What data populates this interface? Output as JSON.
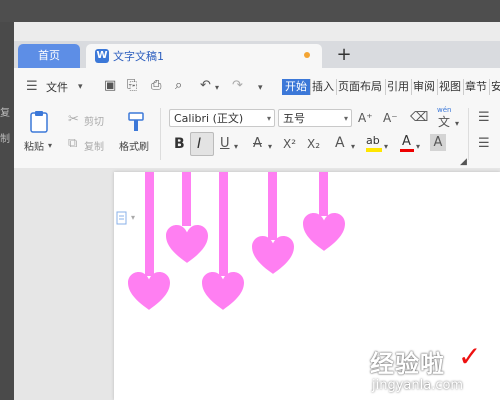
{
  "left_fragments": [
    "复",
    "制"
  ],
  "tabs": {
    "home_label": "首页",
    "doc_label": "文字文稿1",
    "doc_badge": "W",
    "new_tab_glyph": "+"
  },
  "menubar": {
    "file_label": "文件",
    "tabs": [
      "开始",
      "插入",
      "页面布局",
      "引用",
      "审阅",
      "视图",
      "章节",
      "安"
    ]
  },
  "ribbon": {
    "paste_label": "粘贴",
    "cut_label": "剪切",
    "copy_label": "复制",
    "format_painter_label": "格式刷",
    "font_name": "Calibri (正文)",
    "font_size": "五号",
    "bold": "B",
    "italic": "I",
    "underline": "U",
    "strikethrough": "A",
    "superscript": "X²",
    "subscript": "X₂",
    "text_effect": "A",
    "highlight": "ab",
    "font_color": "A",
    "char_shading": "A",
    "grow_font": "A⁺",
    "shrink_font": "A⁻",
    "phonetic_top": "wén",
    "phonetic_bottom": "文"
  },
  "document": {
    "heart_color": "#ff7ff2"
  },
  "watermark": {
    "text": "经验啦",
    "url": "jingyanla.com"
  }
}
